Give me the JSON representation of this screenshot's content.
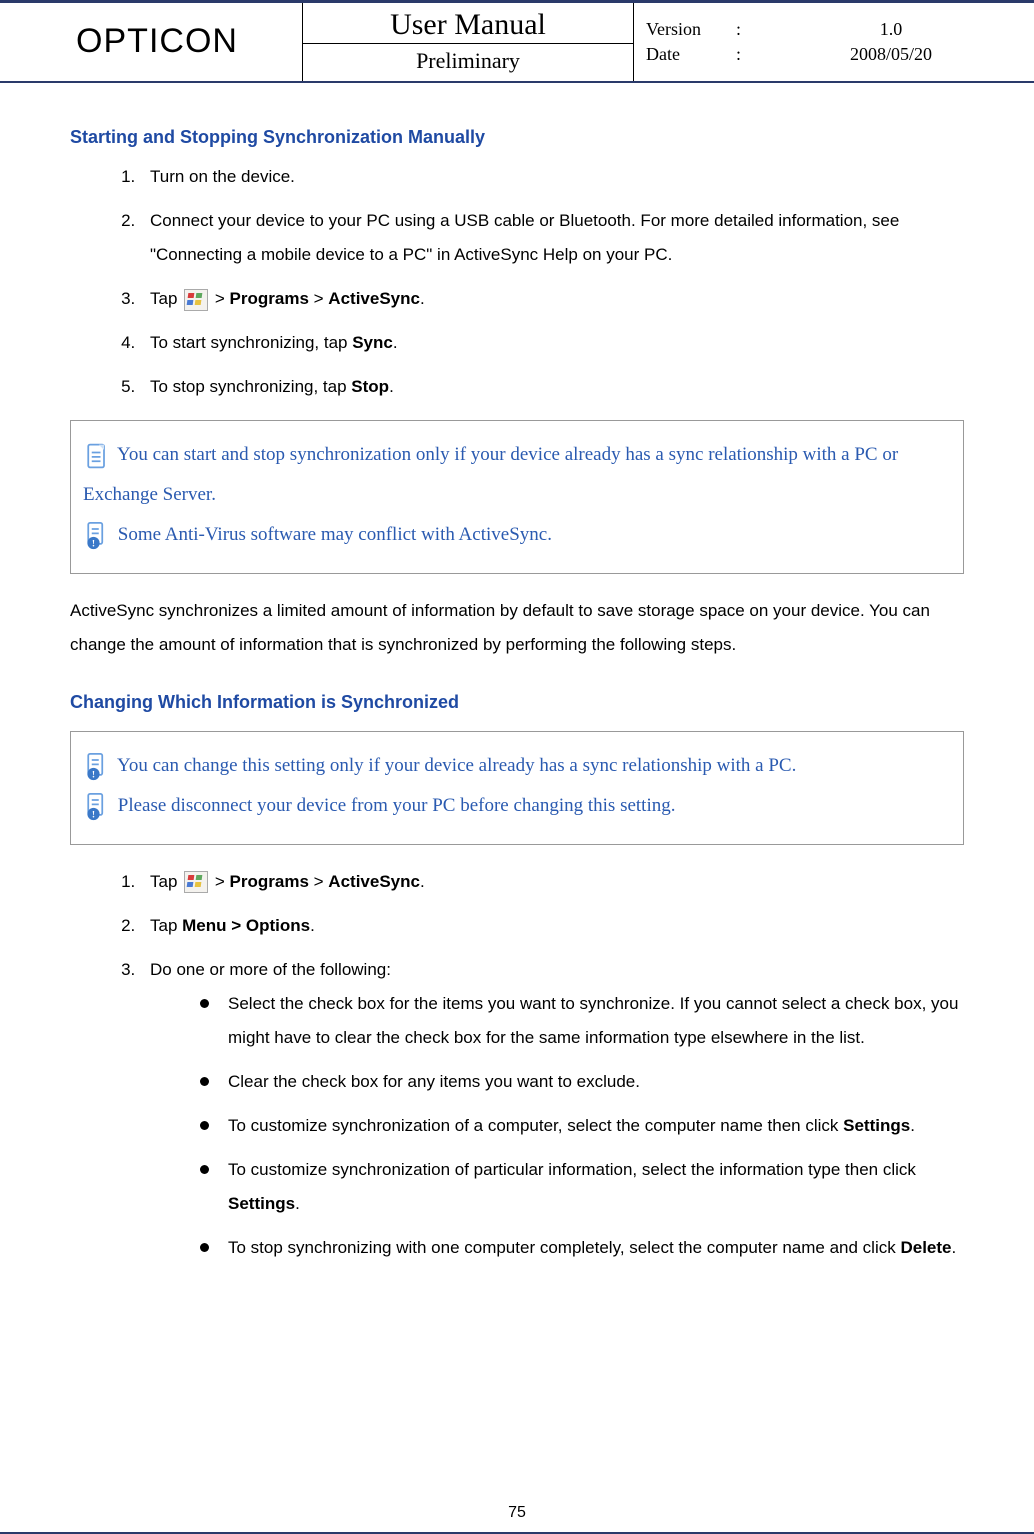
{
  "header": {
    "brand": "OPTICON",
    "title": "User Manual",
    "subtitle": "Preliminary",
    "version_label": "Version",
    "version_value": "1.0",
    "date_label": "Date",
    "date_value": "2008/05/20",
    "colon": ":"
  },
  "section1": {
    "title": "Starting and Stopping Synchronization Manually",
    "steps": {
      "s1": "Turn on the device.",
      "s2": "Connect your device to your PC using a USB cable or Bluetooth. For more detailed information, see \"Connecting a mobile device to a PC\" in ActiveSync Help on your PC.",
      "s3_pre": "Tap ",
      "s3_post": " > ",
      "s3_programs": "Programs",
      "s3_active": "ActiveSync",
      "s3_period": ".",
      "s4_pre": "To start synchronizing, tap ",
      "s4_bold": "Sync",
      "s4_post": ".",
      "s5_pre": "To stop synchronizing, tap ",
      "s5_bold": "Stop",
      "s5_post": "."
    },
    "note1": "You can start and stop synchronization only if your device already has a sync relationship with a PC or Exchange Server.",
    "note2": "Some Anti-Virus software may conflict with ActiveSync."
  },
  "midpara": "ActiveSync synchronizes a limited amount of information by default to save storage space on your device. You can change the amount of information that is synchronized by performing the following steps.",
  "section2": {
    "title": "Changing Which Information is Synchronized",
    "note1": "You can change this setting only if your device already has a sync relationship with a PC.",
    "note2": "Please disconnect your device from your PC before changing this setting.",
    "steps": {
      "s1_pre": "Tap ",
      "s1_programs": "Programs",
      "s1_active": "ActiveSync",
      "s2_pre": "Tap ",
      "s2_bold": "Menu > Options",
      "s2_post": ".",
      "s3": "Do one or more of the following:",
      "bullets": {
        "b1": "Select the check box for the items you want to synchronize. If you cannot select a check box, you might have to clear the check box for the same information type elsewhere in the list.",
        "b2": "Clear the check box for any items you want to exclude.",
        "b3_pre": "To customize synchronization of a computer, select the computer name then click ",
        "b3_bold": "Settings",
        "b3_post": ".",
        "b4_pre": "To customize synchronization of particular information, select the information type then click ",
        "b4_bold": "Settings",
        "b4_post": ".",
        "b5_pre": "To stop synchronizing with one computer completely, select the computer name and click ",
        "b5_bold": "Delete",
        "b5_post": "."
      }
    }
  },
  "page_number": "75",
  "gt": ">"
}
